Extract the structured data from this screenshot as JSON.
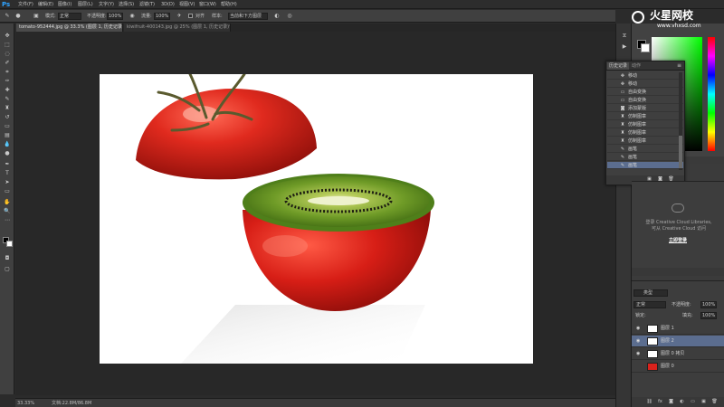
{
  "app": {
    "logo": "Ps",
    "menus": [
      "文件(F)",
      "编辑(E)",
      "图像(I)",
      "图层(L)",
      "文字(Y)",
      "选择(S)",
      "滤镜(T)",
      "3D(D)",
      "视图(V)",
      "窗口(W)",
      "帮助(H)"
    ]
  },
  "options": {
    "mode_label": "模式:",
    "mode_value": "正常",
    "opacity_label": "不透明度:",
    "opacity_value": "100%",
    "flow_label": "流量:",
    "flow_value": "100%",
    "align_label": "对齐",
    "sample_label": "样本:",
    "sample_value": "当前和下方图层"
  },
  "tabs": [
    {
      "label": "tomato-952444.jpg @ 33.3% (图层 1, 历史记录)*",
      "active": true
    },
    {
      "label": "kiwifruit-400143.jpg @ 25% (图层 1, 历史记录)*",
      "active": false
    }
  ],
  "status": {
    "zoom": "33.33%",
    "doc": "文档:22.8M/86.8M"
  },
  "history": {
    "tabs": [
      "历史记录",
      "动作"
    ],
    "rows": [
      {
        "icon": "move-icon",
        "label": "移动",
        "selected": false
      },
      {
        "icon": "move-icon",
        "label": "移动",
        "selected": false
      },
      {
        "icon": "transform-icon",
        "label": "自由变换",
        "selected": false
      },
      {
        "icon": "transform-icon",
        "label": "自由变换",
        "selected": false
      },
      {
        "icon": "mask-icon",
        "label": "添加蒙版",
        "selected": false
      },
      {
        "icon": "stamp-icon",
        "label": "仿制图章",
        "selected": false
      },
      {
        "icon": "stamp-icon",
        "label": "仿制图章",
        "selected": false
      },
      {
        "icon": "stamp-icon",
        "label": "仿制图章",
        "selected": false
      },
      {
        "icon": "stamp-icon",
        "label": "仿制图章",
        "selected": false
      },
      {
        "icon": "brush-icon",
        "label": "画笔",
        "selected": false
      },
      {
        "icon": "brush-icon",
        "label": "画笔",
        "selected": false
      },
      {
        "icon": "brush-icon",
        "label": "画笔",
        "selected": true
      }
    ]
  },
  "libraries": {
    "line1": "登录 Creative Cloud Libraries,",
    "line2": "可从 Creative Cloud 访问",
    "signin": "立即登录"
  },
  "layers": {
    "kind_label": "类型",
    "blend_value": "正常",
    "opacity_label": "不透明度:",
    "opacity_value": "100%",
    "lock_label": "锁定:",
    "fill_label": "填充:",
    "fill_value": "100%",
    "items": [
      {
        "name": "图层 1",
        "selected": false
      },
      {
        "name": "图层 2",
        "selected": true
      },
      {
        "name": "图层 0 拷贝",
        "selected": false
      },
      {
        "name": "图层 0",
        "selected": false
      }
    ]
  },
  "watermark": {
    "brand": "火星网校",
    "url": "www.vhxsd.com"
  },
  "colors": {
    "accent": "#2fa3ff",
    "selection": "#5b6d8f",
    "tomato": "#d9221c",
    "kiwi": "#6f9b27"
  }
}
